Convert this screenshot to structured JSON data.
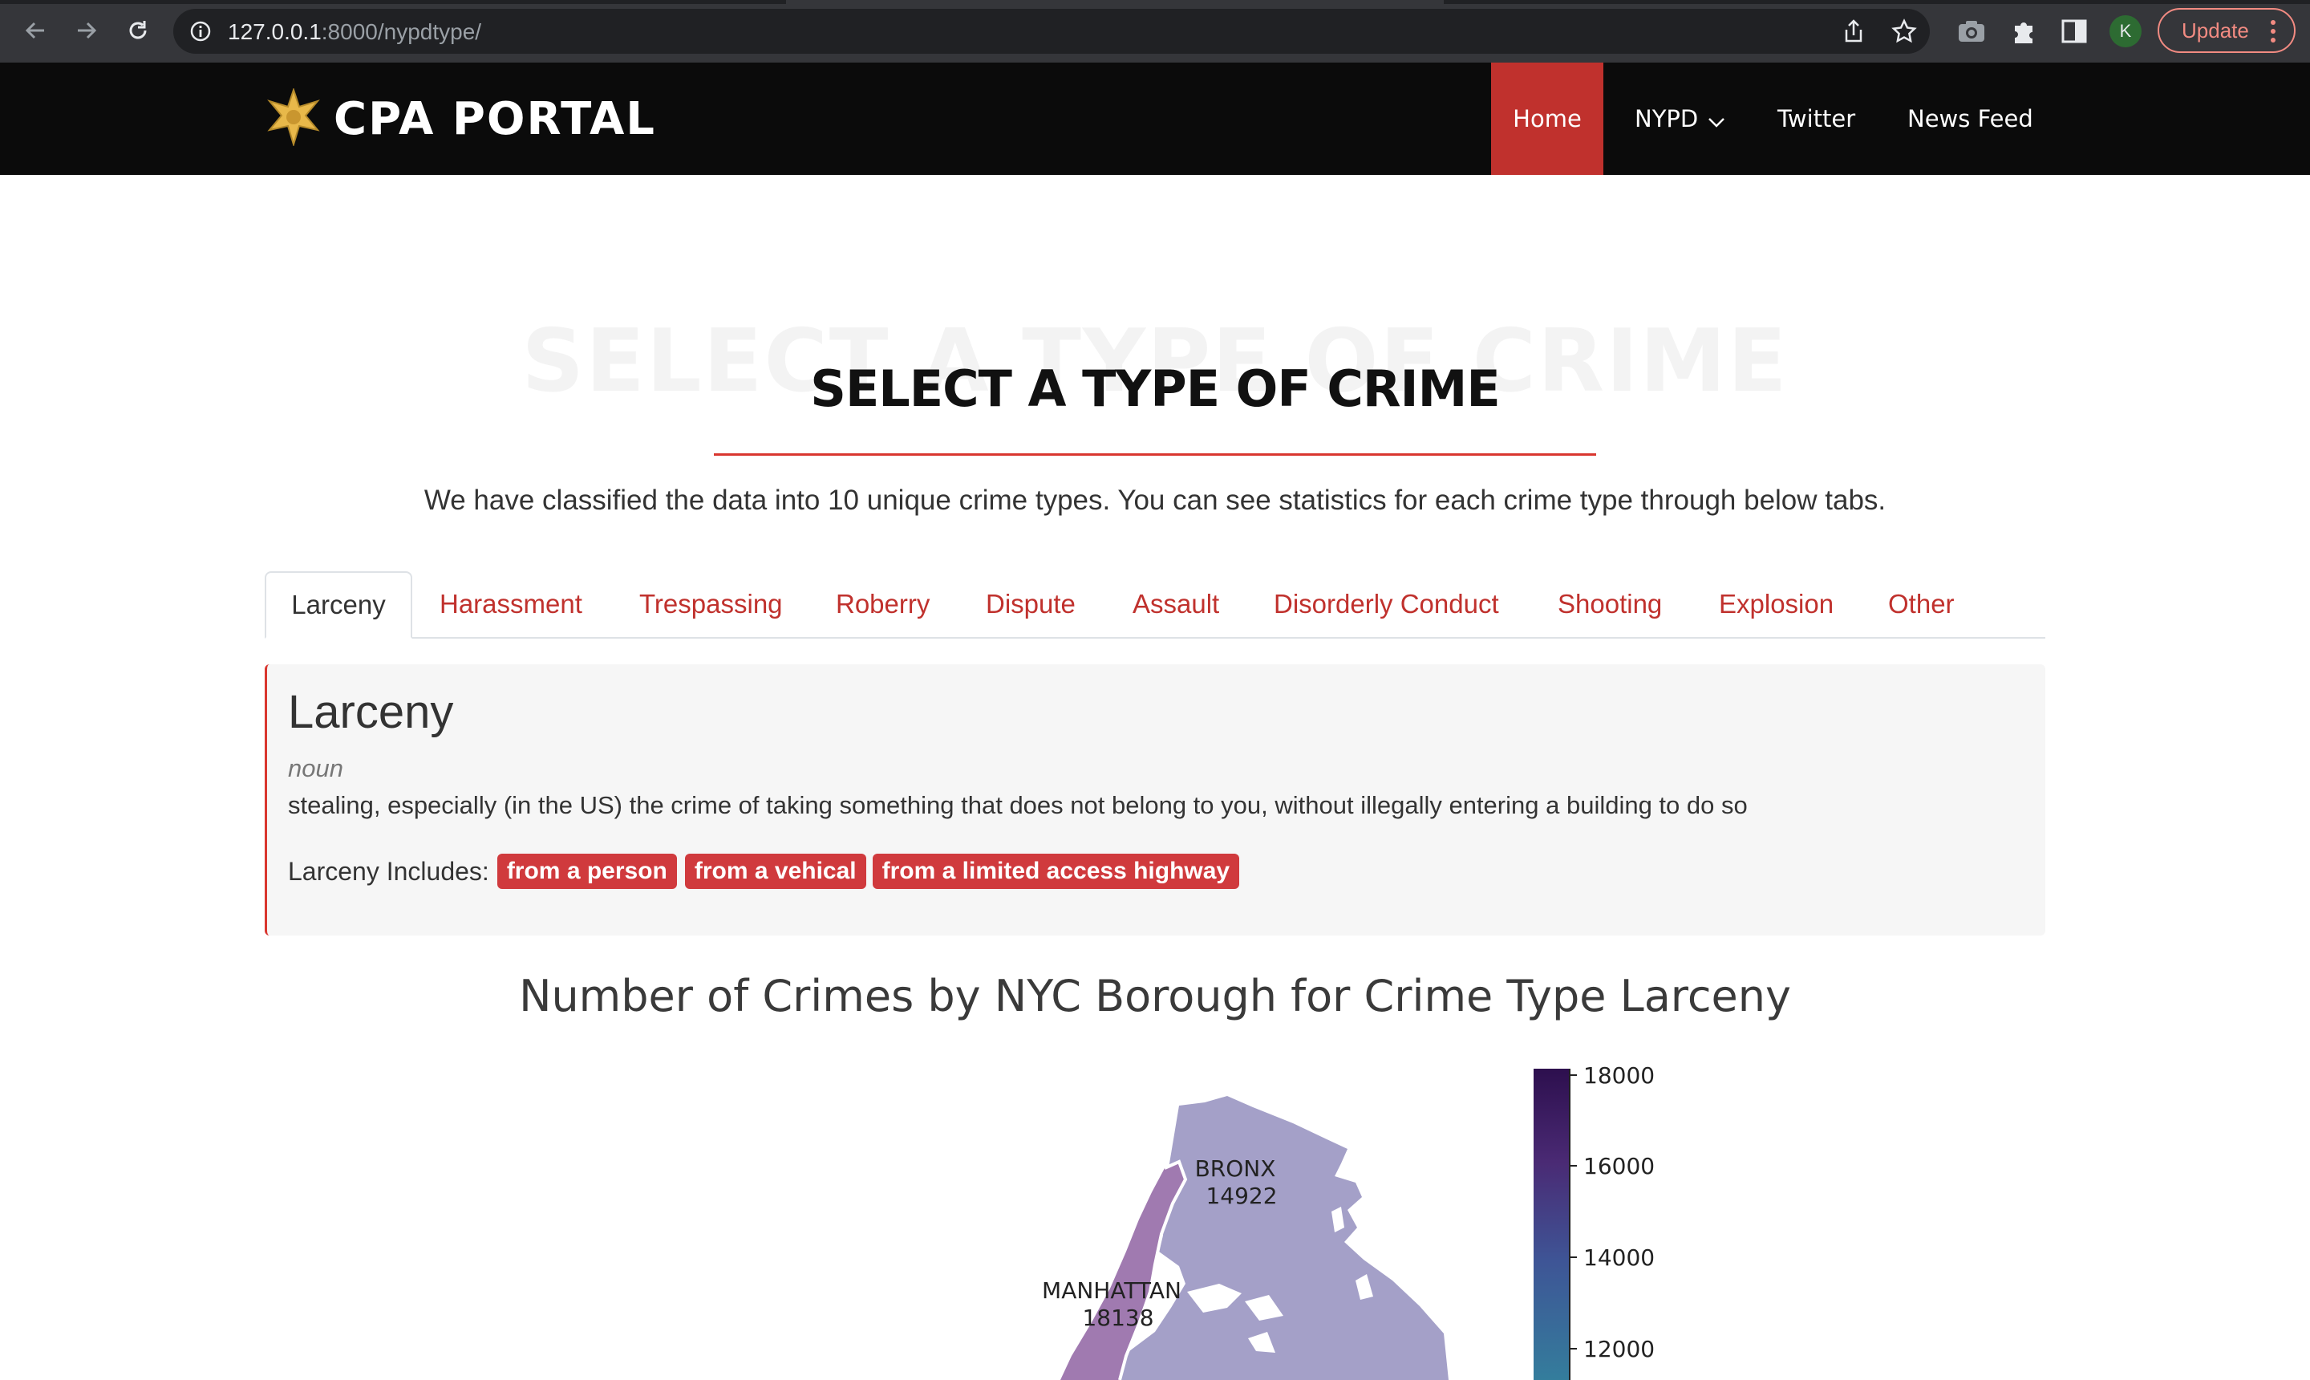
{
  "browser": {
    "url_host": "127.0.0.1",
    "url_rest": ":8000/nypdtype/",
    "profile_initial": "K",
    "update_label": "Update"
  },
  "navbar": {
    "brand": "CPA PORTAL",
    "items": [
      {
        "label": "Home",
        "active": true
      },
      {
        "label": "NYPD",
        "dropdown": true
      },
      {
        "label": "Twitter"
      },
      {
        "label": "News Feed"
      }
    ]
  },
  "section": {
    "ghost_title": "SELECT A TYPE OF CRIME",
    "title": "SELECT A TYPE OF CRIME",
    "subtitle": "We have classified the data into 10 unique crime types. You can see statistics for each crime type through below tabs."
  },
  "tabs": [
    {
      "label": "Larceny",
      "active": true
    },
    {
      "label": "Harassment"
    },
    {
      "label": "Trespassing"
    },
    {
      "label": "Roberry"
    },
    {
      "label": "Dispute"
    },
    {
      "label": "Assault"
    },
    {
      "label": "Disorderly Conduct"
    },
    {
      "label": "Shooting"
    },
    {
      "label": "Explosion"
    },
    {
      "label": "Other"
    }
  ],
  "definition": {
    "title": "Larceny",
    "part_of_speech": "noun",
    "text": "stealing, especially (in the US) the crime of taking something that does not belong to you, without illegally entering a building to do so",
    "includes_label": "Larceny Includes:",
    "includes": [
      "from a person",
      "from a vehical",
      "from a limited access highway"
    ]
  },
  "chart_data": {
    "type": "choropleth",
    "title": "Number of Crimes by NYC Borough for Crime Type Larceny",
    "regions": [
      {
        "name": "BRONX",
        "value": 14922,
        "color": "#a4a0c8"
      },
      {
        "name": "MANHATTAN",
        "value": 18138,
        "color": "#a07ab0"
      }
    ],
    "colorbar": {
      "ticks": [
        "18000",
        "16000",
        "14000",
        "12000"
      ],
      "colors": [
        "#2d0f4e",
        "#4a2a74",
        "#3e5596",
        "#347d9c"
      ]
    }
  }
}
